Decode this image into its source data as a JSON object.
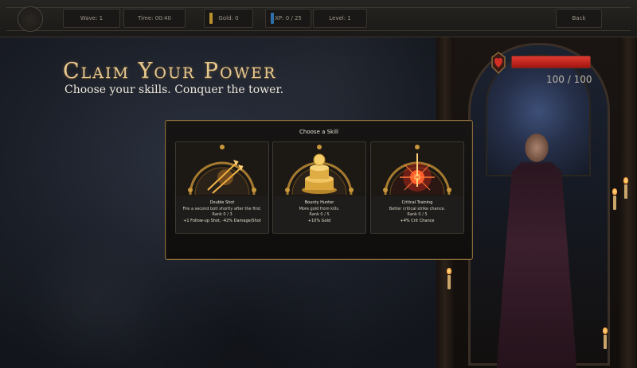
{
  "hud": {
    "wave": "Wave: 1",
    "time": "Time: 00:40",
    "gold": "Gold: 0",
    "xp": "XP: 0 / 25",
    "level": "Level: 1",
    "back_label": "Back",
    "gold_color": "#b8902e",
    "xp_color": "#2f6ea8"
  },
  "header": {
    "title": "Claim Your Power",
    "subtitle": "Choose your skills. Conquer the tower."
  },
  "health": {
    "text": "100 / 100",
    "current": 100,
    "max": 100,
    "color": "#d12f26"
  },
  "skill_modal": {
    "title": "Choose a Skill",
    "skills": [
      {
        "name": "Double Shot",
        "description": "Fire a second bolt shortly after the first.",
        "rank": "Rank 0 / 3",
        "effect": "+1 Follow-up Shot, -42% Damage/Shot",
        "icon": "double-arrow-icon"
      },
      {
        "name": "Bounty Hunter",
        "description": "More gold from kills.",
        "rank": "Rank 0 / 5",
        "effect": "+10% Gold",
        "icon": "gold-coins-icon"
      },
      {
        "name": "Critical Training",
        "description": "Better critical strike chance.",
        "rank": "Rank 0 / 5",
        "effect": "+4% Crit Chance",
        "icon": "critical-burst-icon"
      }
    ]
  }
}
